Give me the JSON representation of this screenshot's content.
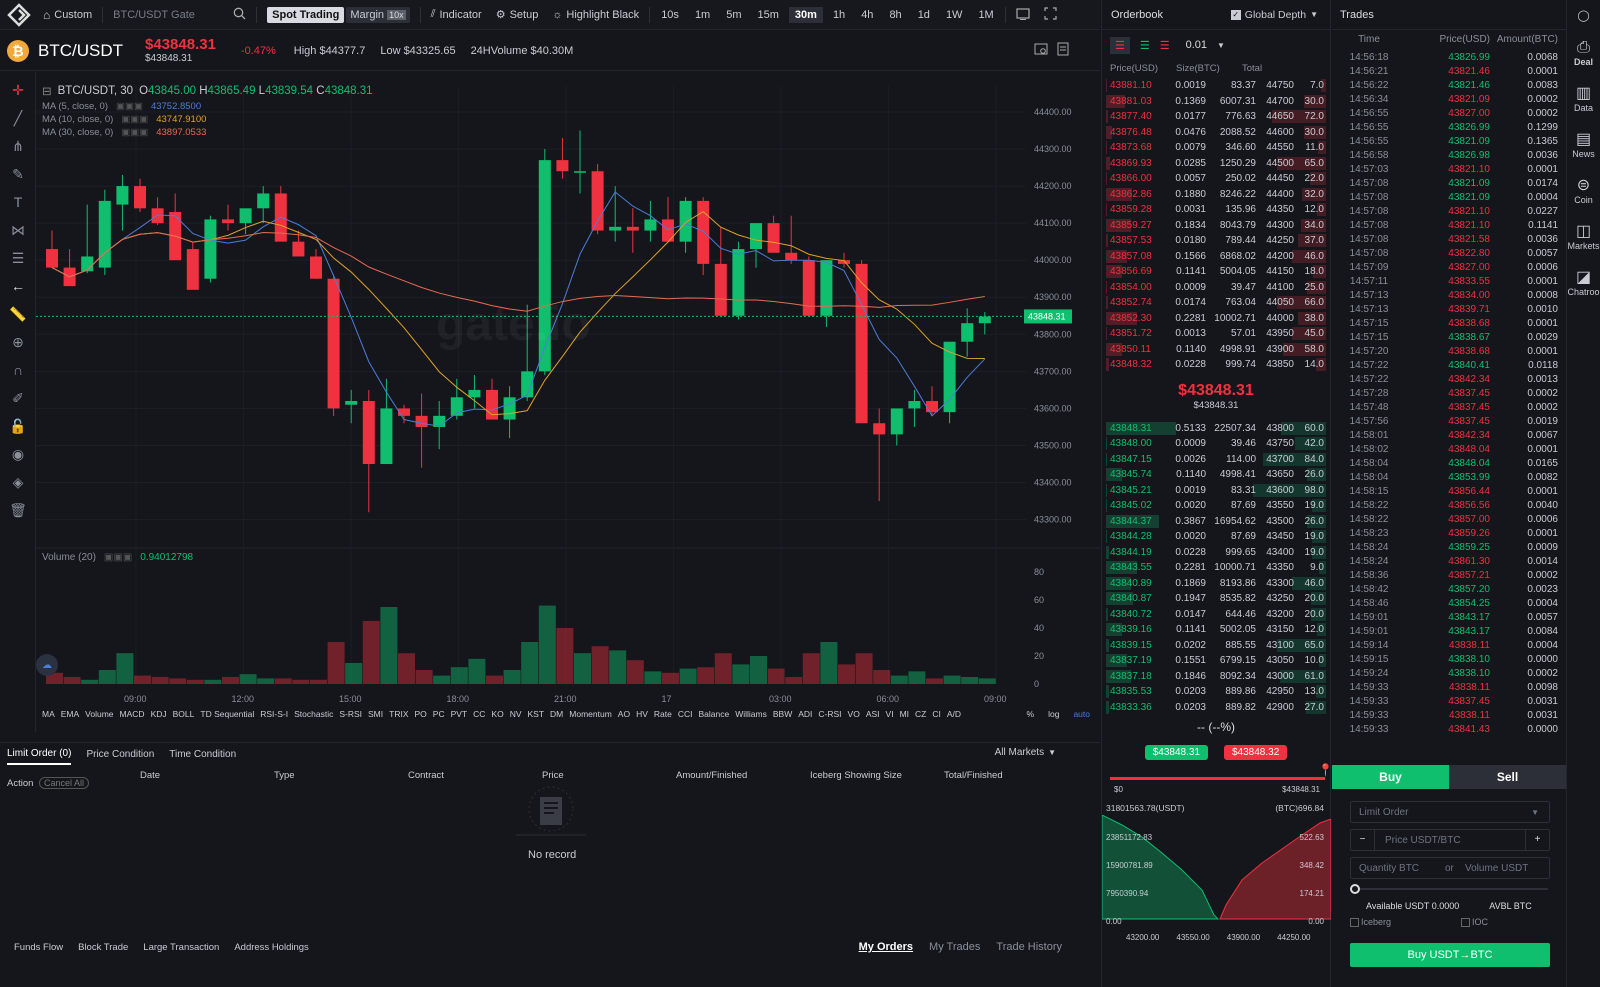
{
  "toolbar": {
    "custom": "Custom",
    "symbol_search": "BTC/USDT Gate",
    "spot_trading": "Spot Trading",
    "margin": "Margin",
    "margin_lev": "10x",
    "indicator": "Indicator",
    "setup": "Setup",
    "highlight": "Highlight Black",
    "intervals": [
      "10s",
      "1m",
      "5m",
      "15m",
      "30m",
      "1h",
      "4h",
      "8h",
      "1d",
      "1W",
      "1M"
    ],
    "active_interval": "30m"
  },
  "market": {
    "pair": "BTC/USDT",
    "price": "$43848.31",
    "price_sub": "$43848.31",
    "change": "-0.47%",
    "high": "High $44377.7",
    "low": "Low $43325.65",
    "volume": "24HVolume $40.30M"
  },
  "chart": {
    "legend_title": "BTC/USDT, 30",
    "o_label": "O",
    "o": "43845.00",
    "h_label": "H",
    "h": "43865.49",
    "l_label": "L",
    "l": "43839.54",
    "c_label": "C",
    "c": "43848.31",
    "ma5_label": "MA (5, close, 0)",
    "ma5": "43752.8500",
    "ma10_label": "MA (10, close, 0)",
    "ma10": "43747.9100",
    "ma30_label": "MA (30, close, 0)",
    "ma30": "43897.0533",
    "volume_label": "Volume (20)",
    "volume_val": "0.94012798",
    "current_price_tag": "43848.31",
    "watermark": "gate.io",
    "ma5_color": "#4c7dd8",
    "ma10_color": "#e0a127",
    "ma30_color": "#e86a52",
    "up_color": "#0fbf6e",
    "down_color": "#f0313f",
    "indicators": [
      "MA",
      "EMA",
      "Volume",
      "MACD",
      "KDJ",
      "BOLL",
      "TD Sequential",
      "RSI-S-I",
      "Stochastic",
      "S-RSI",
      "SMI",
      "TRIX",
      "PO",
      "PC",
      "PVT",
      "CC",
      "KO",
      "NV",
      "KST",
      "DM",
      "Momentum",
      "AO",
      "HV",
      "Rate",
      "CCI",
      "Balance",
      "Williams",
      "BBW",
      "ADI",
      "C-RSI",
      "VO",
      "ASI",
      "VI",
      "MI",
      "CZ",
      "CI",
      "A/D"
    ],
    "scale_opts": [
      "%",
      "log",
      "auto"
    ]
  },
  "chart_data": {
    "type": "candlestick",
    "price_ticks": [
      44400,
      44300,
      44200,
      44100,
      44000,
      43900,
      43800,
      43700,
      43600,
      43500,
      43400,
      43300
    ],
    "price_tick_labels": [
      "44400.00",
      "44300.00",
      "44200.00",
      "44100.00",
      "44000.00",
      "43900.00",
      "43800.00",
      "43700.00",
      "43600.00",
      "43500.00",
      "43400.00",
      "43300.00"
    ],
    "ylim": [
      43245,
      44470
    ],
    "time_labels": [
      "09:00",
      "12:00",
      "15:00",
      "18:00",
      "21:00",
      "17",
      "03:00",
      "06:00",
      "09:00"
    ],
    "volume_ticks": [
      "80",
      "60",
      "40",
      "20",
      "0"
    ],
    "volume_ylim": [
      0,
      90
    ],
    "candles": [
      [
        44030,
        44080,
        43990,
        43980
      ],
      [
        43980,
        44030,
        43960,
        43930
      ],
      [
        43970,
        44150,
        43965,
        44010
      ],
      [
        43980,
        44190,
        43960,
        44160
      ],
      [
        44150,
        44230,
        44080,
        44200
      ],
      [
        44200,
        44220,
        44130,
        44140
      ],
      [
        44140,
        44170,
        44095,
        44100
      ],
      [
        44130,
        44180,
        44090,
        44000
      ],
      [
        44030,
        44050,
        43950,
        43920
      ],
      [
        43950,
        44120,
        43940,
        44110
      ],
      [
        44110,
        44150,
        44080,
        44100
      ],
      [
        44100,
        44130,
        44070,
        44140
      ],
      [
        44140,
        44200,
        44100,
        44180
      ],
      [
        44180,
        44200,
        44080,
        44050
      ],
      [
        44050,
        44080,
        44020,
        44010
      ],
      [
        44010,
        44030,
        43950,
        43950
      ],
      [
        43950,
        43960,
        43580,
        43600
      ],
      [
        43610,
        43650,
        43560,
        43620
      ],
      [
        43620,
        43650,
        43320,
        43450
      ],
      [
        43450,
        43680,
        43450,
        43600
      ],
      [
        43600,
        43610,
        43560,
        43580
      ],
      [
        43580,
        43640,
        43440,
        43550
      ],
      [
        43550,
        43620,
        43490,
        43580
      ],
      [
        43580,
        43680,
        43570,
        43630
      ],
      [
        43630,
        43690,
        43600,
        43650
      ],
      [
        43650,
        43680,
        43580,
        43570
      ],
      [
        43570,
        43660,
        43520,
        43630
      ],
      [
        43630,
        43880,
        43620,
        43700
      ],
      [
        43700,
        44300,
        43690,
        44270
      ],
      [
        44270,
        44330,
        44220,
        44240
      ],
      [
        44240,
        44350,
        44180,
        44240
      ],
      [
        44240,
        44260,
        44070,
        44080
      ],
      [
        44080,
        44200,
        44050,
        44090
      ],
      [
        44090,
        44140,
        44020,
        44080
      ],
      [
        44080,
        44160,
        44050,
        44110
      ],
      [
        44110,
        44170,
        44060,
        44050
      ],
      [
        44050,
        44170,
        44020,
        44160
      ],
      [
        44160,
        44170,
        43960,
        43990
      ],
      [
        43990,
        44090,
        43910,
        43850
      ],
      [
        43850,
        44050,
        43840,
        44030
      ],
      [
        44030,
        44080,
        43980,
        44100
      ],
      [
        44100,
        44120,
        44040,
        44020
      ],
      [
        44020,
        44120,
        43990,
        44000
      ],
      [
        44000,
        44010,
        43900,
        43850
      ],
      [
        43850,
        44000,
        43820,
        44000
      ],
      [
        44000,
        44020,
        43980,
        43990
      ],
      [
        43990,
        44000,
        43560,
        43560
      ],
      [
        43560,
        43600,
        43350,
        43530
      ],
      [
        43530,
        43580,
        43500,
        43600
      ],
      [
        43600,
        43650,
        43550,
        43620
      ],
      [
        43620,
        43660,
        43580,
        43590
      ],
      [
        43590,
        43700,
        43560,
        43780
      ],
      [
        43780,
        43870,
        43740,
        43830
      ],
      [
        43830,
        43860,
        43800,
        43848
      ]
    ],
    "volumes": [
      8,
      5,
      3,
      10,
      22,
      6,
      5,
      4,
      3,
      3,
      5,
      7,
      4,
      4,
      3,
      3,
      30,
      15,
      45,
      55,
      22,
      10,
      6,
      12,
      18,
      6,
      10,
      30,
      56,
      40,
      22,
      27,
      24,
      17,
      9,
      8,
      11,
      12,
      22,
      14,
      20,
      11,
      5,
      22,
      30,
      14,
      22,
      10,
      6,
      9,
      4,
      6,
      5,
      4
    ]
  },
  "orderbook": {
    "title": "Orderbook",
    "global_depth": "Global Depth",
    "precision": "0.01",
    "col_price": "Price(USD)",
    "col_size": "Size(BTC)",
    "col_total": "Total",
    "asks": [
      [
        "43881.10",
        "0.0019",
        "83.37",
        "44750",
        "7.0"
      ],
      [
        "43881.03",
        "0.1369",
        "6007.31",
        "44700",
        "30.0"
      ],
      [
        "43877.40",
        "0.0177",
        "776.63",
        "44650",
        "72.0"
      ],
      [
        "43876.48",
        "0.0476",
        "2088.52",
        "44600",
        "30.0"
      ],
      [
        "43873.68",
        "0.0079",
        "346.60",
        "44550",
        "11.0"
      ],
      [
        "43869.93",
        "0.0285",
        "1250.29",
        "44500",
        "65.0"
      ],
      [
        "43866.00",
        "0.0057",
        "250.02",
        "44450",
        "22.0"
      ],
      [
        "43862.86",
        "0.1880",
        "8246.22",
        "44400",
        "32.0"
      ],
      [
        "43859.28",
        "0.0031",
        "135.96",
        "44350",
        "12.0"
      ],
      [
        "43859.27",
        "0.1834",
        "8043.79",
        "44300",
        "34.0"
      ],
      [
        "43857.53",
        "0.0180",
        "789.44",
        "44250",
        "37.0"
      ],
      [
        "43857.08",
        "0.1566",
        "6868.02",
        "44200",
        "46.0"
      ],
      [
        "43856.69",
        "0.1141",
        "5004.05",
        "44150",
        "18.0"
      ],
      [
        "43854.00",
        "0.0009",
        "39.47",
        "44100",
        "25.0"
      ],
      [
        "43852.74",
        "0.0174",
        "763.04",
        "44050",
        "66.0"
      ],
      [
        "43852.30",
        "0.2281",
        "10002.71",
        "44000",
        "38.0"
      ],
      [
        "43851.72",
        "0.0013",
        "57.01",
        "43950",
        "45.0"
      ],
      [
        "43850.11",
        "0.1140",
        "4998.91",
        "43900",
        "58.0"
      ],
      [
        "43848.32",
        "0.0228",
        "999.74",
        "43850",
        "14.0"
      ]
    ],
    "mid_price": "$43848.31",
    "mid_sub": "$43848.31",
    "bids": [
      [
        "43848.31",
        "0.5133",
        "22507.34",
        "43800",
        "60.0"
      ],
      [
        "43848.00",
        "0.0009",
        "39.46",
        "43750",
        "42.0"
      ],
      [
        "43847.15",
        "0.0026",
        "114.00",
        "43700",
        "84.0"
      ],
      [
        "43845.74",
        "0.1140",
        "4998.41",
        "43650",
        "26.0"
      ],
      [
        "43845.21",
        "0.0019",
        "83.31",
        "43600",
        "98.0"
      ],
      [
        "43845.02",
        "0.0020",
        "87.69",
        "43550",
        "19.0"
      ],
      [
        "43844.37",
        "0.3867",
        "16954.62",
        "43500",
        "26.0"
      ],
      [
        "43844.28",
        "0.0020",
        "87.69",
        "43450",
        "19.0"
      ],
      [
        "43844.19",
        "0.0228",
        "999.65",
        "43400",
        "19.0"
      ],
      [
        "43843.55",
        "0.2281",
        "10000.71",
        "43350",
        "9.0"
      ],
      [
        "43840.89",
        "0.1869",
        "8193.86",
        "43300",
        "46.0"
      ],
      [
        "43840.87",
        "0.1947",
        "8535.82",
        "43250",
        "20.0"
      ],
      [
        "43840.72",
        "0.0147",
        "644.46",
        "43200",
        "20.0"
      ],
      [
        "43839.16",
        "0.1141",
        "5002.05",
        "43150",
        "12.0"
      ],
      [
        "43839.15",
        "0.0202",
        "885.55",
        "43100",
        "65.0"
      ],
      [
        "43837.19",
        "0.1551",
        "6799.15",
        "43050",
        "10.0"
      ],
      [
        "43837.18",
        "0.1846",
        "8092.34",
        "43000",
        "61.0"
      ],
      [
        "43835.53",
        "0.0203",
        "889.86",
        "42950",
        "13.0"
      ],
      [
        "43833.36",
        "0.0203",
        "889.82",
        "42900",
        "27.0"
      ]
    ],
    "ratio": "-- (--%)",
    "best_bid": "$43848.31",
    "best_ask": "$43848.32",
    "depth_left": "$0",
    "depth_right": "$43848.31",
    "depth_usd": "31801563.78(USDT)",
    "depth_btc": "(BTC)696.84",
    "depth_left_ticks": [
      "23851172.83",
      "15900781.89",
      "7950390.94",
      "0.00"
    ],
    "depth_right_ticks": [
      "522.63",
      "348.42",
      "174.21",
      "0.00"
    ],
    "depth_x_ticks": [
      "43200.00",
      "43550.00",
      "43900.00",
      "44250.00"
    ]
  },
  "trades": {
    "title": "Trades",
    "col_time": "Time",
    "col_price": "Price(USD)",
    "col_amount": "Amount(BTC)",
    "rows": [
      [
        "14:56:18",
        "43826.99",
        "0.0068",
        "up"
      ],
      [
        "14:56:21",
        "43821.46",
        "0.0001",
        "dn"
      ],
      [
        "14:56:22",
        "43821.46",
        "0.0083",
        "up"
      ],
      [
        "14:56:34",
        "43821.09",
        "0.0002",
        "dn"
      ],
      [
        "14:56:55",
        "43827.00",
        "0.0002",
        "dn"
      ],
      [
        "14:56:55",
        "43826.99",
        "0.1299",
        "up"
      ],
      [
        "14:56:55",
        "43821.09",
        "0.1365",
        "up"
      ],
      [
        "14:56:58",
        "43826.98",
        "0.0036",
        "up"
      ],
      [
        "14:57:03",
        "43821.10",
        "0.0001",
        "dn"
      ],
      [
        "14:57:08",
        "43821.09",
        "0.0174",
        "up"
      ],
      [
        "14:57:08",
        "43821.09",
        "0.0004",
        "up"
      ],
      [
        "14:57:08",
        "43821.10",
        "0.0227",
        "dn"
      ],
      [
        "14:57:08",
        "43821.10",
        "0.1141",
        "dn"
      ],
      [
        "14:57:08",
        "43821.58",
        "0.0036",
        "dn"
      ],
      [
        "14:57:08",
        "43822.80",
        "0.0057",
        "dn"
      ],
      [
        "14:57:09",
        "43827.00",
        "0.0006",
        "dn"
      ],
      [
        "14:57:11",
        "43833.55",
        "0.0001",
        "dn"
      ],
      [
        "14:57:13",
        "43834.00",
        "0.0008",
        "dn"
      ],
      [
        "14:57:13",
        "43839.71",
        "0.0010",
        "dn"
      ],
      [
        "14:57:15",
        "43838.68",
        "0.0001",
        "dn"
      ],
      [
        "14:57:15",
        "43838.67",
        "0.0029",
        "up"
      ],
      [
        "14:57:20",
        "43838.68",
        "0.0001",
        "dn"
      ],
      [
        "14:57:22",
        "43840.41",
        "0.0118",
        "up"
      ],
      [
        "14:57:22",
        "43842.34",
        "0.0013",
        "dn"
      ],
      [
        "14:57:28",
        "43837.45",
        "0.0002",
        "dn"
      ],
      [
        "14:57:48",
        "43837.45",
        "0.0002",
        "dn"
      ],
      [
        "14:57:56",
        "43837.45",
        "0.0019",
        "dn"
      ],
      [
        "14:58:01",
        "43842.34",
        "0.0067",
        "dn"
      ],
      [
        "14:58:02",
        "43848.04",
        "0.0001",
        "dn"
      ],
      [
        "14:58:04",
        "43848.04",
        "0.0165",
        "up"
      ],
      [
        "14:58:04",
        "43853.99",
        "0.0082",
        "up"
      ],
      [
        "14:58:15",
        "43856.44",
        "0.0001",
        "dn"
      ],
      [
        "14:58:22",
        "43856.56",
        "0.0040",
        "dn"
      ],
      [
        "14:58:22",
        "43857.00",
        "0.0006",
        "dn"
      ],
      [
        "14:58:23",
        "43859.26",
        "0.0001",
        "dn"
      ],
      [
        "14:58:24",
        "43859.25",
        "0.0009",
        "up"
      ],
      [
        "14:58:24",
        "43861.30",
        "0.0014",
        "dn"
      ],
      [
        "14:58:36",
        "43857.21",
        "0.0002",
        "dn"
      ],
      [
        "14:58:42",
        "43857.20",
        "0.0023",
        "up"
      ],
      [
        "14:58:46",
        "43854.25",
        "0.0004",
        "up"
      ],
      [
        "14:59:01",
        "43843.17",
        "0.0057",
        "up"
      ],
      [
        "14:59:01",
        "43843.17",
        "0.0084",
        "up"
      ],
      [
        "14:59:14",
        "43838.11",
        "0.0004",
        "dn"
      ],
      [
        "14:59:15",
        "43838.10",
        "0.0000",
        "up"
      ],
      [
        "14:59:24",
        "43838.10",
        "0.0002",
        "up"
      ],
      [
        "14:59:33",
        "43838.11",
        "0.0098",
        "dn"
      ],
      [
        "14:59:33",
        "43837.45",
        "0.0031",
        "dn"
      ],
      [
        "14:59:33",
        "43838.11",
        "0.0031",
        "dn"
      ],
      [
        "14:59:33",
        "43841.43",
        "0.0000",
        "dn"
      ]
    ]
  },
  "orderform": {
    "buy": "Buy",
    "sell": "Sell",
    "order_type": "Limit Order",
    "price_placeholder": "Price USDT/BTC",
    "minus": "−",
    "plus": "+",
    "quantity": "Quantity BTC",
    "or": "or",
    "volume": "Volume USDT",
    "available": "Available USDT 0.0000",
    "avbl": "AVBL BTC",
    "iceberg": "Iceberg",
    "ioc": "IOC",
    "submit": "Buy USDT→BTC"
  },
  "rightnav": [
    {
      "label": "Deal",
      "icon": "deal-icon"
    },
    {
      "label": "Data",
      "icon": "data-icon"
    },
    {
      "label": "News",
      "icon": "news-icon"
    },
    {
      "label": "Coin",
      "icon": "coin-icon"
    },
    {
      "label": "Markets",
      "icon": "markets-icon"
    },
    {
      "label": "Chatroo",
      "icon": "chatroom-icon"
    }
  ],
  "bottom": {
    "tabs": [
      "Limit Order (0)",
      "Price Condition",
      "Time Condition"
    ],
    "all_markets": "All Markets",
    "action": "Action",
    "cancel_all": "Cancel All",
    "cols": [
      "Date",
      "Type",
      "Contract",
      "Price",
      "Amount/Finished",
      "Iceberg Showing Size",
      "Total/Finished"
    ],
    "no_record": "No record",
    "footer_links": [
      "Funds Flow",
      "Block Trade",
      "Large Transaction",
      "Address Holdings"
    ],
    "footer_tabs": [
      "My Orders",
      "My Trades",
      "Trade History"
    ]
  }
}
